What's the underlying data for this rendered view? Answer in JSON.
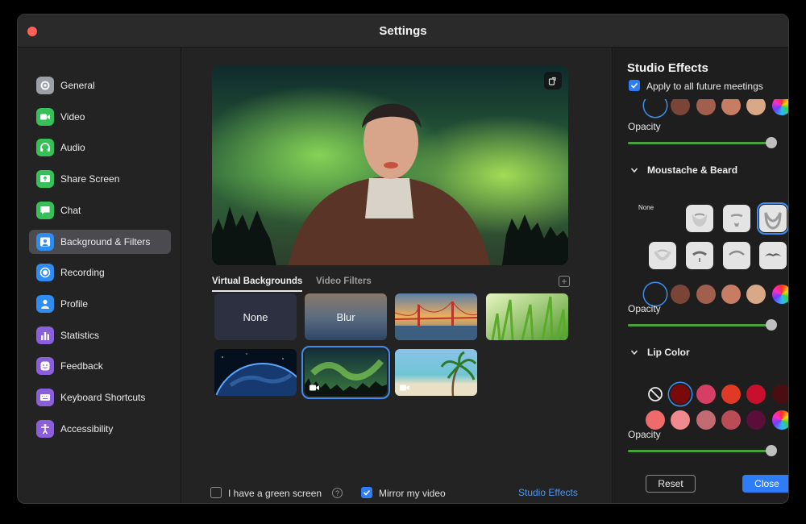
{
  "window": {
    "title": "Settings"
  },
  "sidebar": {
    "items": [
      {
        "label": "General",
        "icon": "gear-icon",
        "color": "#9aa0a6"
      },
      {
        "label": "Video",
        "icon": "video-camera-icon",
        "color": "#37c05a"
      },
      {
        "label": "Audio",
        "icon": "headphones-icon",
        "color": "#37c05a"
      },
      {
        "label": "Share Screen",
        "icon": "share-screen-icon",
        "color": "#37c05a"
      },
      {
        "label": "Chat",
        "icon": "chat-bubble-icon",
        "color": "#37c05a"
      },
      {
        "label": "Background & Filters",
        "icon": "person-background-icon",
        "color": "#2f8cf0"
      },
      {
        "label": "Recording",
        "icon": "record-icon",
        "color": "#2f8cf0"
      },
      {
        "label": "Profile",
        "icon": "profile-icon",
        "color": "#2f8cf0"
      },
      {
        "label": "Statistics",
        "icon": "bar-chart-icon",
        "color": "#8b5fdc"
      },
      {
        "label": "Feedback",
        "icon": "smiley-icon",
        "color": "#8b5fdc"
      },
      {
        "label": "Keyboard Shortcuts",
        "icon": "keyboard-icon",
        "color": "#8b5fdc"
      },
      {
        "label": "Accessibility",
        "icon": "accessibility-icon",
        "color": "#8b5fdc"
      }
    ],
    "active_index": 5
  },
  "main": {
    "tabs": [
      {
        "label": "Virtual Backgrounds",
        "active": true
      },
      {
        "label": "Video Filters",
        "active": false
      }
    ],
    "backgrounds": [
      {
        "label": "None",
        "kind": "none"
      },
      {
        "label": "Blur",
        "kind": "blur"
      },
      {
        "label": "",
        "kind": "golden-gate"
      },
      {
        "label": "",
        "kind": "grass"
      },
      {
        "label": "",
        "kind": "earth"
      },
      {
        "label": "",
        "kind": "aurora",
        "selected": true,
        "video": true
      },
      {
        "label": "",
        "kind": "beach",
        "video": true
      }
    ],
    "green_screen_label": "I have a green screen",
    "green_screen_checked": false,
    "mirror_label": "Mirror my video",
    "mirror_checked": true,
    "studio_effects_link": "Studio Effects"
  },
  "studio": {
    "title": "Studio Effects",
    "apply_future_label": "Apply to all future meetings",
    "apply_future_checked": true,
    "opacity_label": "Opacity",
    "opacity_value": 1.0,
    "eyebrow_colors": [
      "#1e1e1e",
      "#7a4436",
      "#a35f4d",
      "#c67d64",
      "#d9a887",
      "rainbow"
    ],
    "moustache_section": "Moustache & Beard",
    "none_label": "None",
    "beard_colors": [
      "#1e1e1e",
      "#7a4436",
      "#a35f4d",
      "#c67d64",
      "#d9a887",
      "rainbow"
    ],
    "lip_section": "Lip Color",
    "lip_colors_row1": [
      "none",
      "#7a0a0a",
      "#d63e63",
      "#e03a26",
      "#c8102e",
      "#4a0e12"
    ],
    "lip_colors_row2": [
      "#ef6a6a",
      "#f08a8f",
      "#c26b72",
      "#b94c57",
      "#5a0e3a",
      "rainbow"
    ],
    "reset_label": "Reset",
    "close_label": "Close"
  }
}
